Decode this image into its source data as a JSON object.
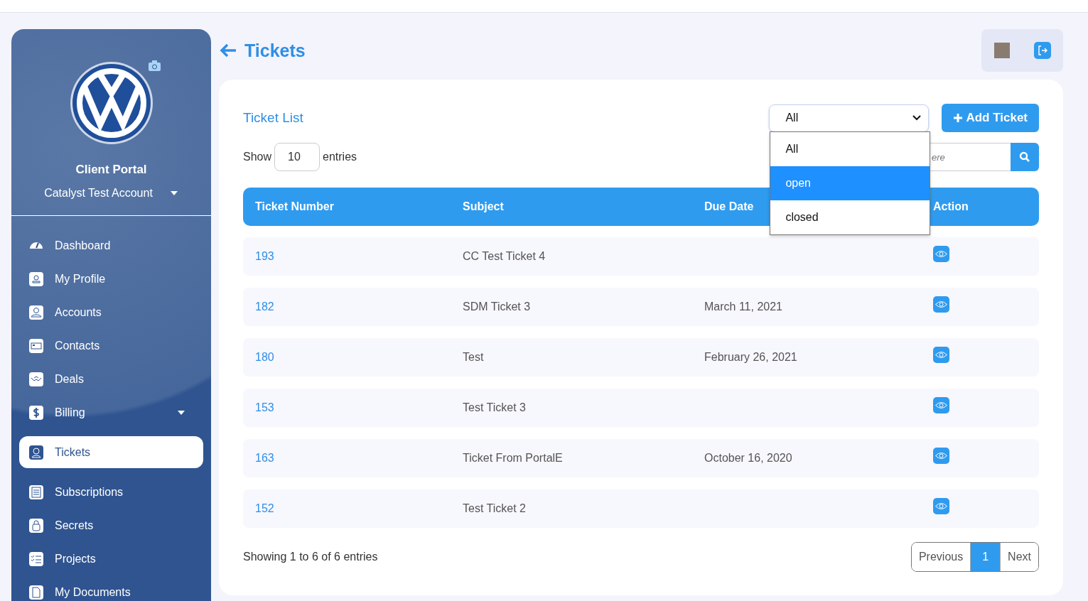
{
  "sidebar": {
    "title": "Client Portal",
    "account": "Catalyst Test Account",
    "items": [
      {
        "label": "Dashboard",
        "selected": false,
        "expandable": false
      },
      {
        "label": "My Profile",
        "selected": false,
        "expandable": false
      },
      {
        "label": "Accounts",
        "selected": false,
        "expandable": false
      },
      {
        "label": "Contacts",
        "selected": false,
        "expandable": false
      },
      {
        "label": "Deals",
        "selected": false,
        "expandable": false
      },
      {
        "label": "Billing",
        "selected": false,
        "expandable": true
      },
      {
        "label": "Tickets",
        "selected": true,
        "expandable": false
      },
      {
        "label": "Subscriptions",
        "selected": false,
        "expandable": false
      },
      {
        "label": "Secrets",
        "selected": false,
        "expandable": false
      },
      {
        "label": "Projects",
        "selected": false,
        "expandable": false
      },
      {
        "label": "My Documents",
        "selected": false,
        "expandable": false
      }
    ]
  },
  "page_title": "Tickets",
  "card": {
    "title": "Ticket List",
    "filter": {
      "value": "All",
      "expanded": true,
      "options": [
        {
          "label": "All",
          "highlighted": false
        },
        {
          "label": "open",
          "highlighted": true
        },
        {
          "label": "closed",
          "highlighted": false
        }
      ]
    },
    "add_button": "Add Ticket",
    "show_label": "Show",
    "page_size": "10",
    "entries_label": "entries",
    "search": {
      "placeholder": "ere"
    },
    "table": {
      "columns": [
        "Ticket Number",
        "Subject",
        "Due Date",
        "Action"
      ],
      "rows": [
        {
          "number": "193",
          "subject": "CC Test Ticket 4",
          "due_date": ""
        },
        {
          "number": "182",
          "subject": "SDM Ticket 3",
          "due_date": "March 11, 2021"
        },
        {
          "number": "180",
          "subject": "Test",
          "due_date": "February 26, 2021"
        },
        {
          "number": "153",
          "subject": "Test Ticket 3",
          "due_date": ""
        },
        {
          "number": "163",
          "subject": "Ticket From PortalE",
          "due_date": "October 16, 2020"
        },
        {
          "number": "152",
          "subject": "Test Ticket 2",
          "due_date": ""
        }
      ]
    },
    "summary": "Showing 1 to 6 of 6 entries",
    "pagination": [
      {
        "label": "Previous",
        "selected": false
      },
      {
        "label": "1",
        "selected": true
      },
      {
        "label": "Next",
        "selected": false
      }
    ]
  }
}
